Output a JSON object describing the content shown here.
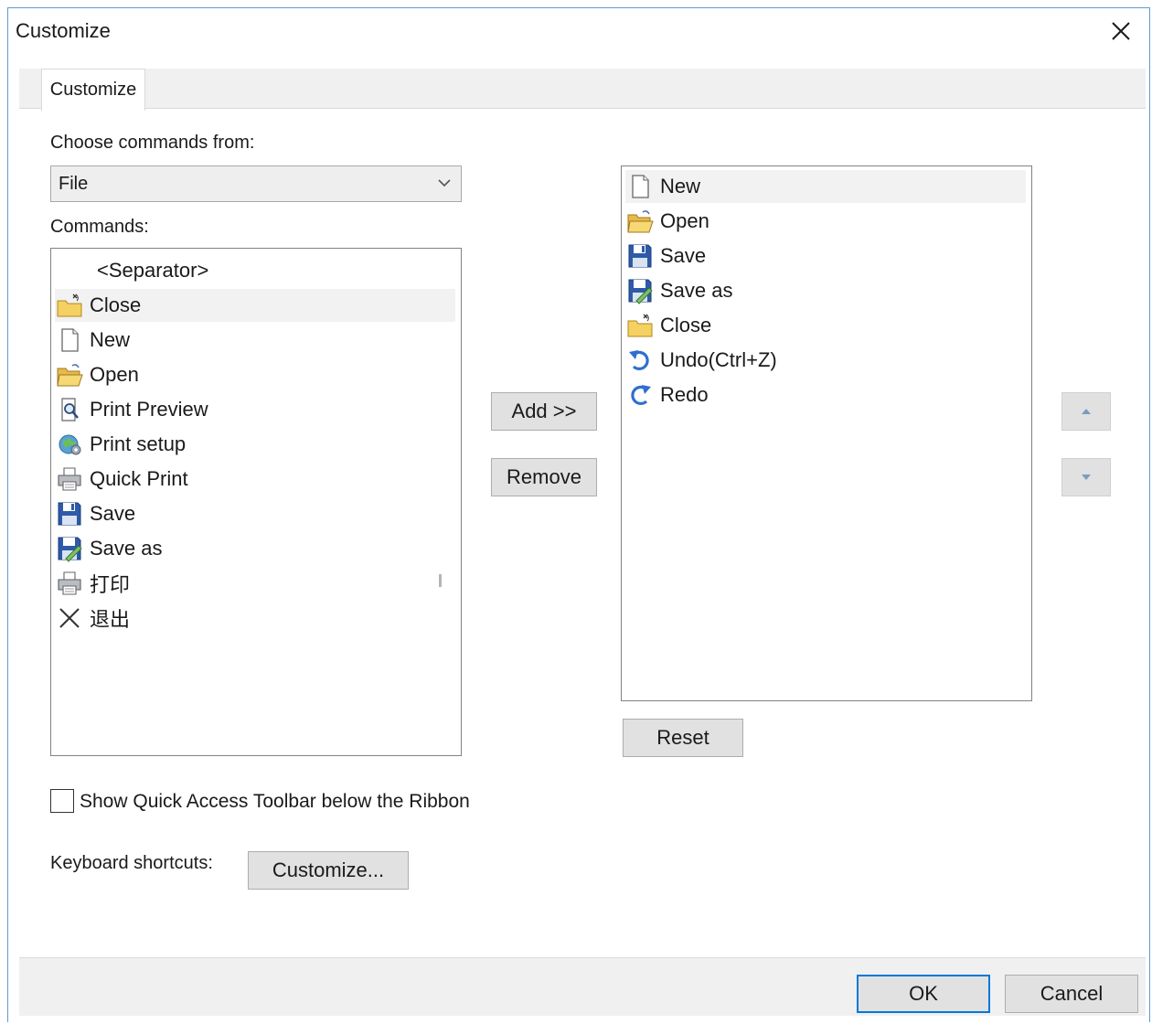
{
  "window": {
    "title": "Customize"
  },
  "tabs": [
    {
      "label": "Customize"
    }
  ],
  "choose": {
    "label": "Choose commands from:",
    "selected": "File"
  },
  "commands": {
    "label": "Commands:",
    "items": [
      {
        "label": "<Separator>",
        "icon": "none"
      },
      {
        "label": "Close",
        "icon": "close-folder-icon"
      },
      {
        "label": "New",
        "icon": "new-document-icon"
      },
      {
        "label": "Open",
        "icon": "open-folder-icon"
      },
      {
        "label": "Print Preview",
        "icon": "print-preview-icon"
      },
      {
        "label": "Print setup",
        "icon": "print-setup-icon"
      },
      {
        "label": "Quick Print",
        "icon": "printer-icon"
      },
      {
        "label": "Save",
        "icon": "save-icon"
      },
      {
        "label": "Save as",
        "icon": "save-as-icon"
      },
      {
        "label": "打印",
        "icon": "printer-icon"
      },
      {
        "label": "退出",
        "icon": "exit-x-icon"
      }
    ]
  },
  "toolbar_items": [
    {
      "label": "New",
      "icon": "new-document-icon"
    },
    {
      "label": "Open",
      "icon": "open-folder-icon"
    },
    {
      "label": "Save",
      "icon": "save-icon"
    },
    {
      "label": "Save as",
      "icon": "save-as-icon"
    },
    {
      "label": "Close",
      "icon": "close-folder-icon"
    },
    {
      "label": "Undo(Ctrl+Z)",
      "icon": "undo-icon"
    },
    {
      "label": "Redo",
      "icon": "redo-icon"
    }
  ],
  "buttons": {
    "add": "Add >>",
    "remove": "Remove",
    "reset": "Reset",
    "customize": "Customize...",
    "ok": "OK",
    "cancel": "Cancel"
  },
  "checkbox": {
    "label": "Show Quick Access Toolbar below the Ribbon",
    "checked": false
  },
  "keyboard": {
    "label": "Keyboard shortcuts:"
  },
  "colors": {
    "accent": "#0078d7",
    "button_face": "#e1e1e1",
    "window_border": "#5b9bd5"
  }
}
